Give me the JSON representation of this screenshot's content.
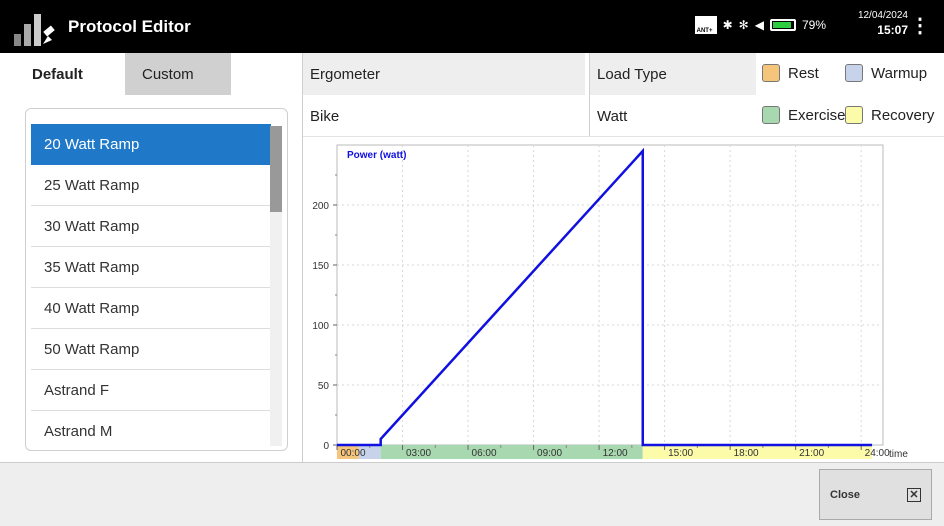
{
  "app": {
    "title": "Protocol Editor"
  },
  "status": {
    "battery": "79%",
    "date": "12/04/2024",
    "time": "15:07",
    "ant_label": "ANT+"
  },
  "tabs": {
    "default": "Default",
    "custom": "Custom"
  },
  "protocols": [
    "20 Watt Ramp",
    "25 Watt Ramp",
    "30 Watt Ramp",
    "35 Watt Ramp",
    "40 Watt Ramp",
    "50 Watt Ramp",
    "Astrand F",
    "Astrand M"
  ],
  "selected_protocol": "20 Watt Ramp",
  "header": {
    "ergometer_label": "Ergometer",
    "ergometer_value": "Bike",
    "loadtype_label": "Load Type",
    "loadtype_value": "Watt"
  },
  "legend": {
    "rest": "Rest",
    "warmup": "Warmup",
    "exercise": "Exercise",
    "recovery": "Recovery",
    "colors": {
      "rest": "#f5c57c",
      "warmup": "#c6d3ea",
      "exercise": "#a8d8b0",
      "recovery": "#fbfbaa"
    }
  },
  "chart_data": {
    "type": "line",
    "ylabel": "Power (watt)",
    "xlabel": "time",
    "x_tick_labels": [
      "00:00",
      "03:00",
      "06:00",
      "09:00",
      "12:00",
      "15:00",
      "18:00",
      "21:00",
      "24:00"
    ],
    "y_tick_labels": [
      "0",
      "50",
      "100",
      "150",
      "200"
    ],
    "ylim": [
      0,
      250
    ],
    "xlim_minutes": [
      0,
      25
    ],
    "series": [
      {
        "x_minutes": [
          0,
          2,
          2,
          14,
          14,
          24.5
        ],
        "y": [
          0,
          0,
          5,
          245,
          0,
          0
        ]
      }
    ],
    "phases": [
      {
        "phase": "rest",
        "start": 0,
        "end": 1
      },
      {
        "phase": "warmup",
        "start": 1,
        "end": 2
      },
      {
        "phase": "exercise",
        "start": 2,
        "end": 14
      },
      {
        "phase": "recovery",
        "start": 14,
        "end": 24.5
      }
    ],
    "line_color": "#1010e0",
    "grid": true
  },
  "footer": {
    "close_label": "Close"
  }
}
